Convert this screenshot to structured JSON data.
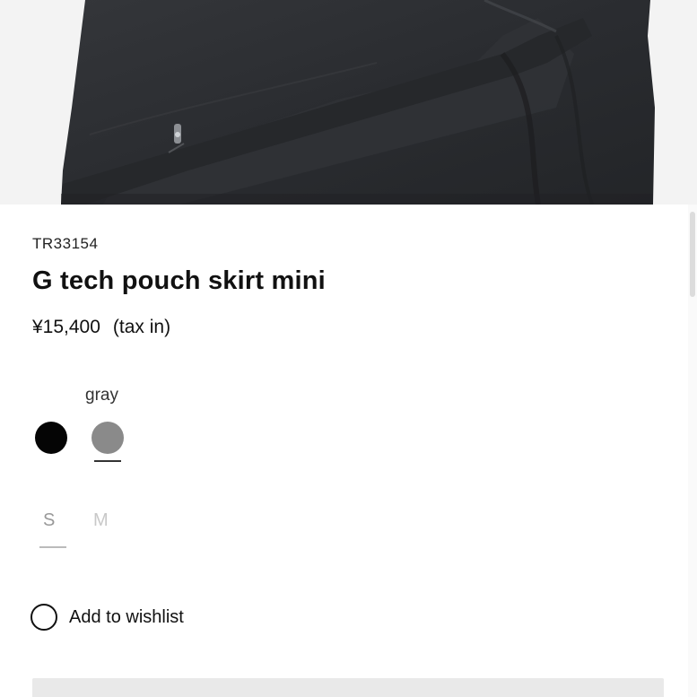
{
  "product": {
    "sku": "TR33154",
    "name": "G tech pouch skirt mini",
    "price": "¥15,400",
    "tax_note": "(tax in)"
  },
  "colors": {
    "selected_name": "gray",
    "options": [
      {
        "name": "black",
        "hex": "#050505"
      },
      {
        "name": "gray",
        "hex": "#8a8a8a"
      }
    ],
    "selected_index": 1
  },
  "sizes": {
    "options": [
      "S",
      "M"
    ],
    "selected": "S"
  },
  "wishlist": {
    "label": "Add to wishlist",
    "icon": "circle-outline-icon"
  },
  "theme": {
    "photo_fabric": "#2b2d31",
    "photo_background": "#f2f2f2"
  }
}
